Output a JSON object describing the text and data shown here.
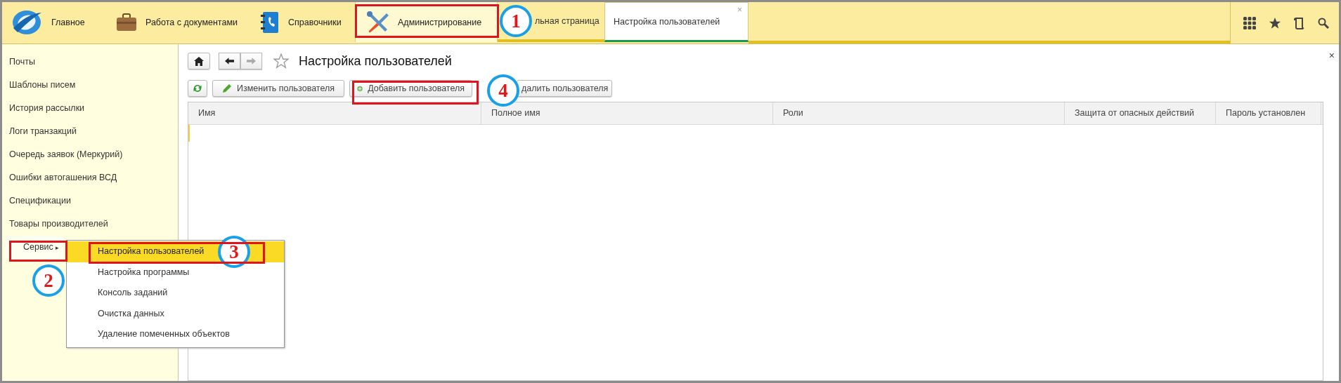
{
  "sections": [
    {
      "label": "Главное",
      "selected": false
    },
    {
      "label": "Работа с документами",
      "selected": false
    },
    {
      "label": "Справочники",
      "selected": false
    },
    {
      "label": "Администрирование",
      "selected": true
    }
  ],
  "open_tabs": [
    {
      "label": "льная страница",
      "selected": false,
      "closable": false
    },
    {
      "label": "Настройка пользователей",
      "selected": true,
      "closable": true
    }
  ],
  "close_symbol": "×",
  "sidebar": {
    "items": [
      {
        "label": "Почты"
      },
      {
        "label": "Шаблоны писем"
      },
      {
        "label": "История рассылки"
      },
      {
        "label": "Логи транзакций"
      },
      {
        "label": "Очередь заявок (Меркурий)"
      },
      {
        "label": "Ошибки автогашения ВСД"
      },
      {
        "label": "Спецификации"
      },
      {
        "label": "Товары производителей"
      }
    ],
    "service": {
      "label": "Сервис",
      "arrow": "▸",
      "expanded": true,
      "items": [
        {
          "label": "Настройка пользователей",
          "selected": true
        },
        {
          "label": "Настройка программы",
          "selected": false
        },
        {
          "label": "Консоль заданий",
          "selected": false
        },
        {
          "label": "Очистка данных",
          "selected": false
        },
        {
          "label": "Удаление помеченных объектов",
          "selected": false
        }
      ]
    }
  },
  "form": {
    "title": "Настройка пользователей",
    "close_symbol": "×",
    "buttons": [
      {
        "label": "Изменить пользователя"
      },
      {
        "label": "Добавить пользователя"
      },
      {
        "label": "далить пользователя"
      }
    ],
    "table": {
      "columns": [
        "Имя",
        "Полное имя",
        "Роли",
        "Защита от опасных действий",
        "Пароль установлен"
      ]
    }
  },
  "annotations": [
    {
      "number": "1"
    },
    {
      "number": "2"
    },
    {
      "number": "3"
    },
    {
      "number": "4"
    }
  ]
}
